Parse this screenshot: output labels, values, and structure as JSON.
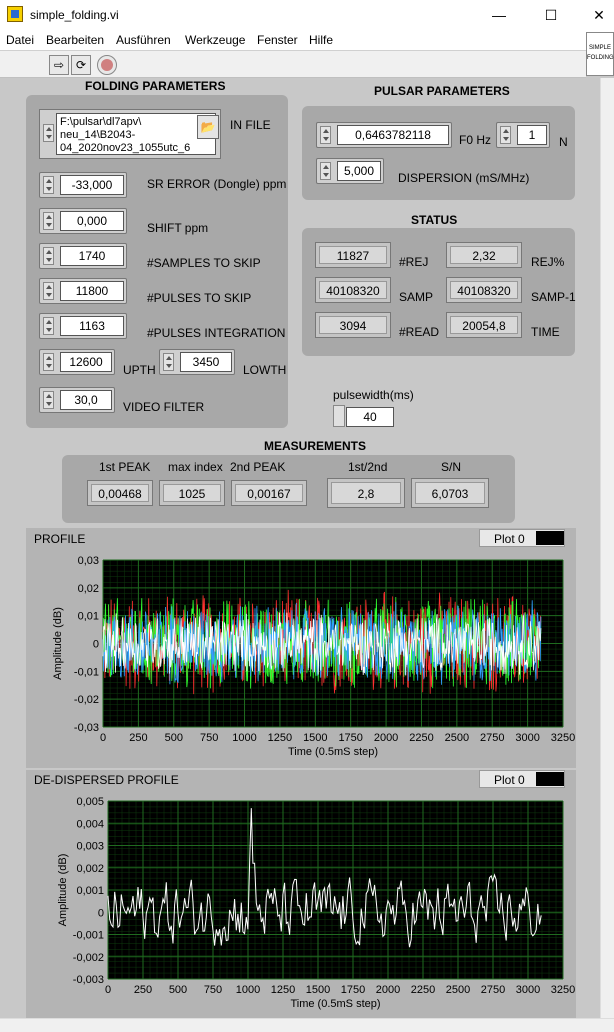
{
  "window": {
    "title": "simple_folding.vi",
    "minimize": "—",
    "maximize": "☐",
    "close": "✕"
  },
  "menu": [
    "Datei",
    "Bearbeiten",
    "Ausführen",
    "Werkzeuge",
    "Fenster",
    "Hilfe"
  ],
  "iconpane": {
    "line1": "SIMPLE",
    "line2": "FOLDING"
  },
  "folding": {
    "heading": "FOLDING PARAMETERS",
    "infile_label": "IN FILE",
    "infile_value": "F:\\pulsar\\dl7apv\\ neu_14\\B2043- 04_2020nov23_1055utc_6",
    "sr_error": {
      "value": "-33,000",
      "label": "SR ERROR (Dongle) ppm"
    },
    "shift": {
      "value": "0,000",
      "label": "SHIFT ppm"
    },
    "samples_skip": {
      "value": "1740",
      "label": "#SAMPLES TO SKIP"
    },
    "pulses_skip": {
      "value": "11800",
      "label": "#PULSES TO SKIP"
    },
    "pulses_int": {
      "value": "1163",
      "label": "#PULSES INTEGRATION"
    },
    "upth": {
      "value": "12600",
      "label": "UPTH"
    },
    "lowth": {
      "value": "3450",
      "label": "LOWTH"
    },
    "video": {
      "value": "30,0",
      "label": "VIDEO FILTER"
    }
  },
  "pulsar": {
    "heading": "PULSAR PARAMETERS",
    "f0": {
      "value": "0,6463782118",
      "label": "F0 Hz"
    },
    "n": {
      "value": "1",
      "label": "N"
    },
    "dispersion": {
      "value": "5,000",
      "label": "DISPERSION (mS/MHz)"
    }
  },
  "status": {
    "heading": "STATUS",
    "rej": {
      "value": "11827",
      "label": "#REJ"
    },
    "rejpct": {
      "value": "2,32",
      "label": "REJ%"
    },
    "samp": {
      "value": "40108320",
      "label": "SAMP"
    },
    "samp1": {
      "value": "40108320",
      "label": "SAMP-1"
    },
    "read": {
      "value": "3094",
      "label": "#READ"
    },
    "time": {
      "value": "20054,8",
      "label": "TIME"
    }
  },
  "pulsewidth": {
    "label": "pulsewidth(ms)",
    "value": "40"
  },
  "measurements": {
    "heading": "MEASUREMENTS",
    "peak1": {
      "label": "1st PEAK",
      "value": "0,00468"
    },
    "maxidx": {
      "label": "max index",
      "value": "1025"
    },
    "peak2": {
      "label": "2nd PEAK",
      "value": "0,00167"
    },
    "ratio": {
      "label": "1st/2nd",
      "value": "2,8"
    },
    "sn": {
      "label": "S/N",
      "value": "6,0703"
    }
  },
  "colors": {
    "plotbg": "#000000",
    "grid": "#1f6b1f",
    "trace": "#ffffff"
  },
  "chart_data": [
    {
      "type": "line",
      "title": "PROFILE",
      "legend": "Plot 0",
      "xlabel": "Time (0.5mS step)",
      "ylabel": "Amplitude (dB)",
      "xlim": [
        0,
        3250
      ],
      "ylim": [
        -0.03,
        0.03
      ],
      "xticks": [
        "0",
        "250",
        "500",
        "750",
        "1000",
        "1250",
        "1500",
        "1750",
        "2000",
        "2250",
        "2500",
        "2750",
        "3000",
        "3250"
      ],
      "yticks": [
        "0,03",
        "0,02",
        "0,01",
        "0",
        "-0,01",
        "-0,02",
        "-0,03"
      ],
      "series": [
        {
          "color": "#ff3030",
          "amplitude": 0.02
        },
        {
          "color": "#30ff30",
          "amplitude": 0.018
        },
        {
          "color": "#30a0ff",
          "amplitude": 0.016
        },
        {
          "color": "#ffffff",
          "amplitude": 0.012
        }
      ],
      "x_max": 3094
    },
    {
      "type": "line",
      "title": "DE-DISPERSED PROFILE",
      "legend": "Plot 0",
      "xlabel": "Time (0.5mS step)",
      "ylabel": "Amplitude (dB)",
      "xlim": [
        0,
        3250
      ],
      "ylim": [
        -0.003,
        0.005
      ],
      "xticks": [
        "0",
        "250",
        "500",
        "750",
        "1000",
        "1250",
        "1500",
        "1750",
        "2000",
        "2250",
        "2500",
        "2750",
        "3000",
        "3250"
      ],
      "yticks": [
        "0,005",
        "0,004",
        "0,003",
        "0,002",
        "0,001",
        "0",
        "-0,001",
        "-0,002",
        "-0,003"
      ],
      "peak": {
        "x": 1025,
        "y": 0.00468
      },
      "x_max": 3094
    }
  ]
}
